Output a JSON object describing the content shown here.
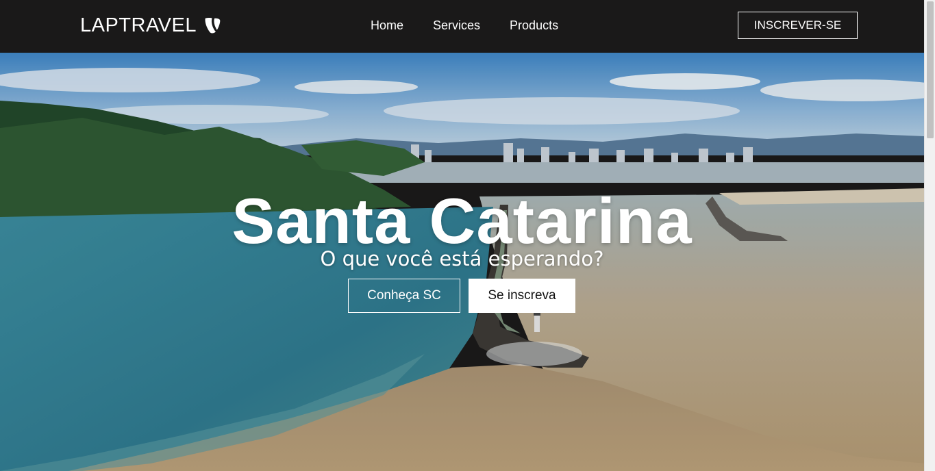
{
  "navbar": {
    "brand_text": "LAPTRAVEL",
    "brand_icon": "typo3-logo-icon",
    "links": [
      "Home",
      "Services",
      "Products"
    ],
    "signup_label": "INSCREVER-SE"
  },
  "hero": {
    "title": "Santa Catarina",
    "subtitle": "O que você está esperando?",
    "primary_button": "Conheça SC",
    "secondary_button": "Se inscreva",
    "background": "aerial-coastal-city-photo"
  },
  "colors": {
    "navbar_bg": "#1a1919",
    "accent_logo": "#ffffff",
    "button_solid_bg": "#ffffff"
  }
}
